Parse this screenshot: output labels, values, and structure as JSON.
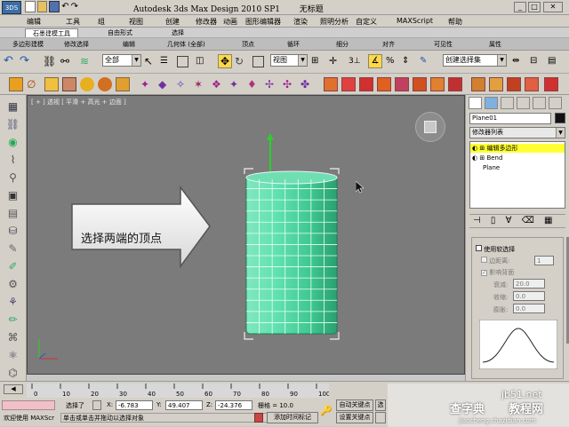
{
  "window": {
    "title": "Autodesk 3ds Max Design 2010 SP1",
    "document": "无标题",
    "logo": "3DS"
  },
  "menus": [
    "编辑",
    "工具",
    "组",
    "视图",
    "创建",
    "修改器",
    "动画",
    "图形编辑器",
    "渲染",
    "照明分析",
    "自定义",
    "MAXScript",
    "帮助"
  ],
  "ribbon_tabs": [
    "石墨建模工具",
    "自由形式",
    "选择"
  ],
  "sub_tabs": [
    "多边形建模",
    "修改选择",
    "编辑",
    "几何体 (全部)",
    "顶点",
    "循环",
    "细分",
    "对齐",
    "可见性",
    "属性"
  ],
  "toolbar": {
    "selection_filter": "全部",
    "ref_coord": "视图",
    "named_selection": "创建选择集",
    "snap_label": "3"
  },
  "viewport": {
    "label": "[ + ] 透视 [ 平滑 + 高光 + 边面 ]",
    "callout_text": "选择两端的顶点"
  },
  "command_panel": {
    "object_name": "Plane01",
    "modifier_list": "修改器列表",
    "stack": [
      "编辑多边形",
      "Bend",
      "Plane"
    ],
    "soft_selection": {
      "use_soft": "使用软选择",
      "edge_distance": "边距离:",
      "edge_distance_value": "1",
      "affect_backfacing": "影响背面",
      "falloff": "衰减:",
      "falloff_value": "20.0",
      "pinch": "收缩:",
      "pinch_value": "0.0",
      "bubble": "膨胀:",
      "bubble_value": "0.0"
    }
  },
  "timeline": {
    "ticks": [
      "0",
      "10",
      "20",
      "30",
      "40",
      "50",
      "60",
      "70",
      "80",
      "90",
      "100"
    ]
  },
  "status": {
    "welcome": "欢迎使用 MAXScr",
    "selected": "选择了",
    "prompt": "单击或单击并拖动以选择对象",
    "x_label": "X:",
    "x_value": "-6.783",
    "y_label": "Y:",
    "y_value": "49.407",
    "z_label": "Z:",
    "z_value": "-24.376",
    "grid": "栅格 = 10.0",
    "add_time_tag": "添加时间标记",
    "auto_key": "自动关键点",
    "set_key": "设置关键点",
    "sel_short": "选",
    "key_filters": "关键点过滤器"
  },
  "watermark": {
    "site": "jb51.net",
    "site_cn": "教程网",
    "brand": "查字典",
    "url": "jiaocheng.chazidian.com"
  },
  "colors": {
    "cylinder": "#4fd6a0",
    "stack_highlight": "#ffff33",
    "viewport_bg": "#7b7b7b"
  }
}
